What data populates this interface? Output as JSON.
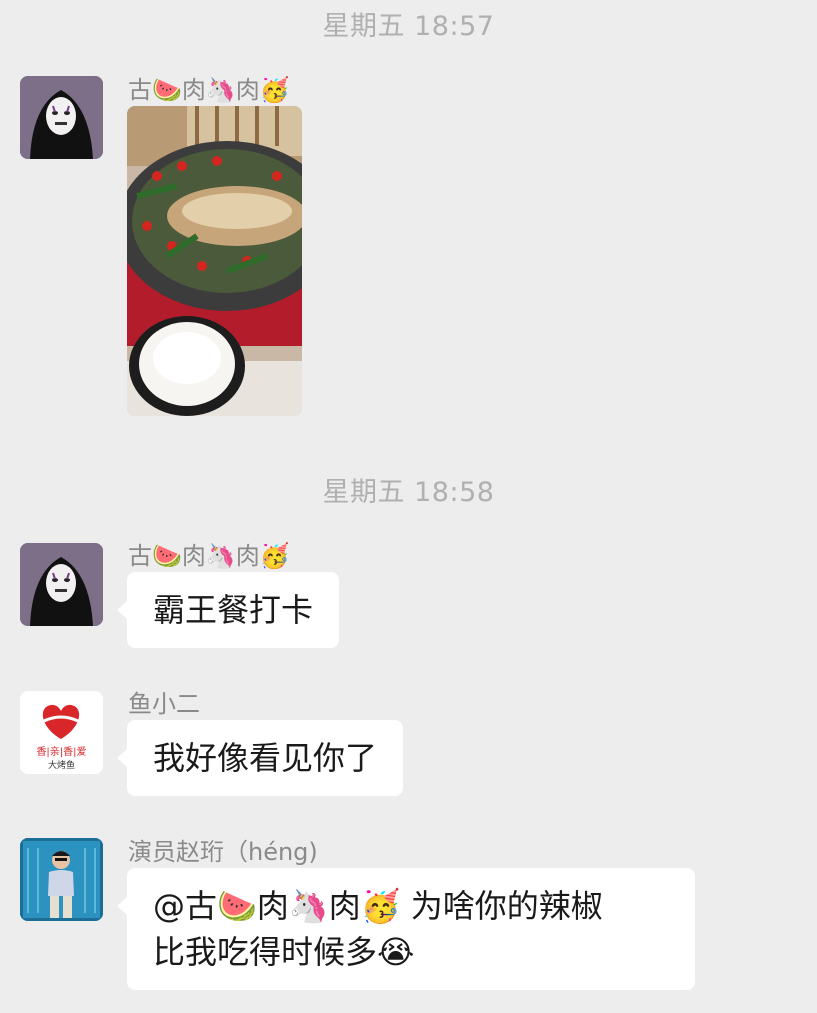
{
  "timestamps": [
    "星期五 18:57",
    "星期五 18:58"
  ],
  "messages": [
    {
      "sender": "古🍉肉🦄肉🥳",
      "type": "image",
      "avatar": "no-face-avatar"
    },
    {
      "sender": "古🍉肉🦄肉🥳",
      "type": "text",
      "text": "霸王餐打卡",
      "avatar": "no-face-avatar"
    },
    {
      "sender": "鱼小二",
      "type": "text",
      "text": "我好像看见你了",
      "avatar": "brand-logo-avatar",
      "avatar_text": {
        "line1": "香|亲|香|爱",
        "line2": "大烤鱼"
      }
    },
    {
      "sender": "演员赵珩（héng)",
      "type": "text",
      "text_line1": "@古🍉肉🦄肉🥳 为啥你的辣椒",
      "text_line2": "比我吃得时候多😭",
      "avatar": "man-avatar"
    }
  ],
  "colors": {
    "background": "#ededed",
    "bubble": "#ffffff",
    "sender": "#8a8a8a",
    "timestamp": "#b0b0b0",
    "brand_red": "#d9262b"
  }
}
